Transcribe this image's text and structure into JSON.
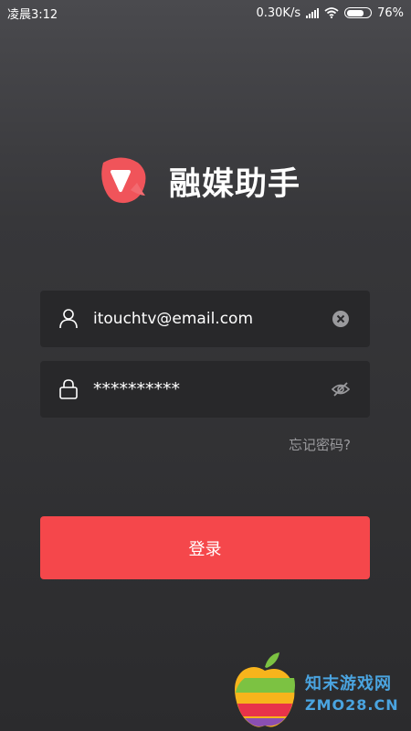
{
  "status_bar": {
    "time": "凌晨3:12",
    "network_speed": "0.30K/s",
    "battery": "76%"
  },
  "brand": {
    "app_name": "融媒助手",
    "logo_icon": "chat-bubble-logo-icon",
    "logo_color": "#f5474b"
  },
  "form": {
    "username": {
      "value": "itouchtv@email.com",
      "icon": "user-icon",
      "clear_icon": "clear-icon"
    },
    "password": {
      "value": "**********",
      "icon": "lock-icon",
      "toggle_icon": "eye-off-icon"
    },
    "forgot_password": "忘记密码?",
    "login_label": "登录"
  },
  "watermark": {
    "line1": "知末游戏网",
    "line2": "ZMO28.CN"
  },
  "colors": {
    "accent": "#f5474b",
    "field_bg": "#28282a",
    "muted_text": "#9a9a9d"
  }
}
